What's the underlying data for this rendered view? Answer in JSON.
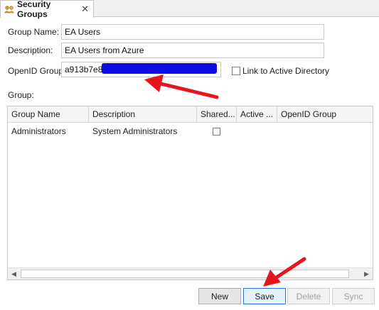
{
  "tab": {
    "title": "Security Groups",
    "close": "✕",
    "icon": "people-group-icon"
  },
  "form": {
    "group_name_label": "Group Name:",
    "group_name_value": "EA Users",
    "description_label": "Description:",
    "description_value": "EA Users from Azure",
    "openid_label": "OpenID Group:",
    "openid_value": "a913b7e8-",
    "link_ad_label": "Link to Active Directory",
    "link_ad_checked": false,
    "group_section_label": "Group:"
  },
  "grid": {
    "columns": [
      "Group Name",
      "Description",
      "Shared...",
      "Active ...",
      "OpenID Group"
    ],
    "rows": [
      {
        "group_name": "Administrators",
        "description": "System Administrators",
        "shared": false,
        "active": "",
        "openid": ""
      }
    ]
  },
  "buttons": {
    "new": "New",
    "save": "Save",
    "delete": "Delete",
    "sync": "Sync"
  },
  "colors": {
    "redaction": "#0a0ce0",
    "annotation_arrow": "#e8141c"
  }
}
